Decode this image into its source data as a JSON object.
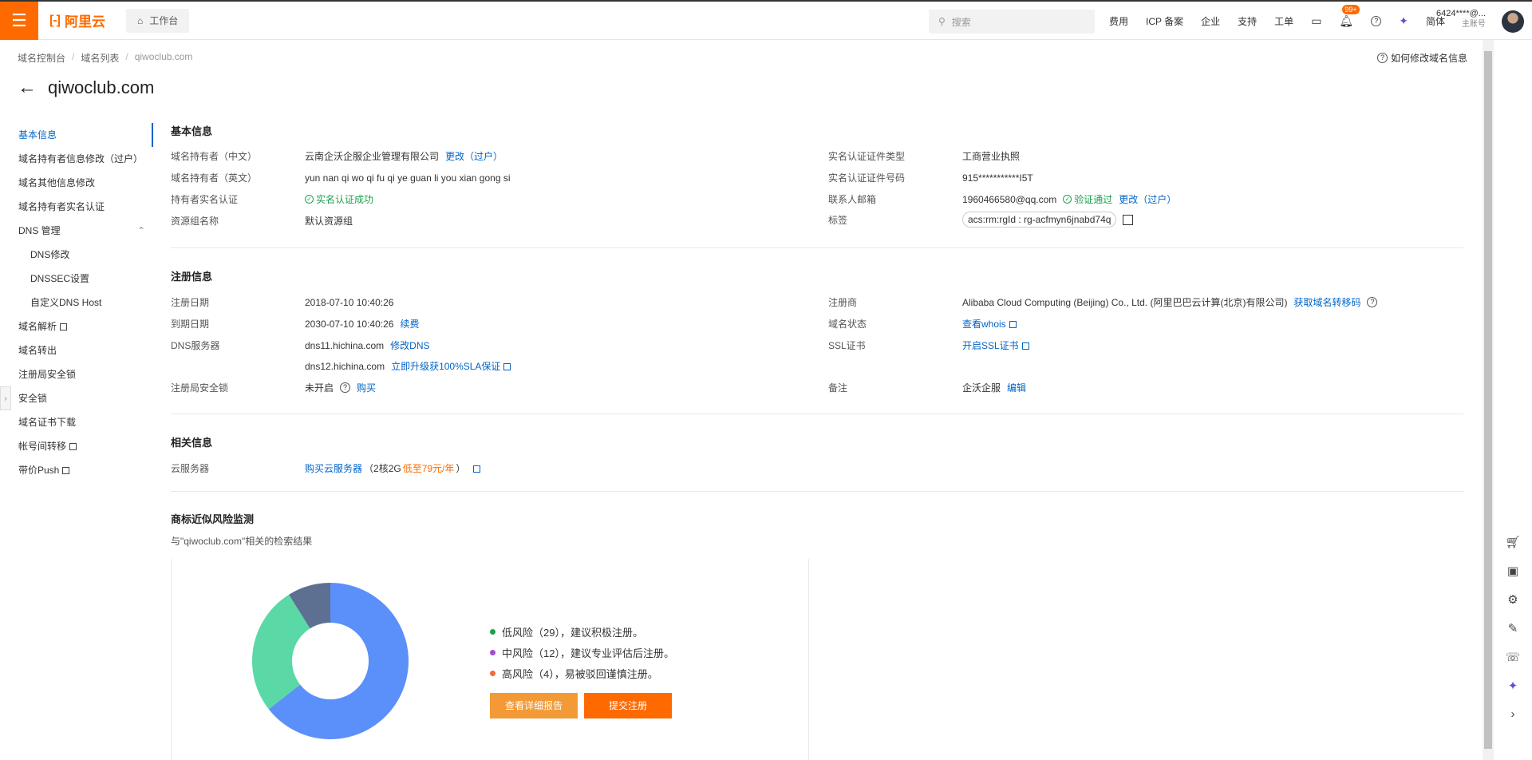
{
  "topbar": {
    "logo_text": "阿里云",
    "workspace": "工作台",
    "search_placeholder": "搜索",
    "nav": [
      "费用",
      "ICP 备案",
      "企业",
      "支持",
      "工单"
    ],
    "badge": "99+",
    "lang": "简体",
    "account_name": "6424****@...",
    "account_sub": "主账号"
  },
  "breadcrumb": [
    "域名控制台",
    "域名列表",
    "qiwoclub.com"
  ],
  "help_link": "如何修改域名信息",
  "title": "qiwoclub.com",
  "sidenav": {
    "items": [
      "基本信息",
      "域名持有者信息修改（过户）",
      "域名其他信息修改",
      "域名持有者实名认证",
      "DNS 管理",
      "DNS修改",
      "DNSSEC设置",
      "自定义DNS Host",
      "域名解析",
      "域名转出",
      "注册局安全锁",
      "安全锁",
      "域名证书下载",
      "帐号间转移",
      "带价Push"
    ]
  },
  "basic": {
    "title": "基本信息",
    "holder_cn_label": "域名持有者（中文）",
    "holder_cn_value": "云南企沃企服企业管理有限公司",
    "holder_cn_link": "更改（过户）",
    "holder_en_label": "域名持有者（英文）",
    "holder_en_value": "yun nan qi wo qi fu qi ye guan li you xian gong si",
    "realname_label": "持有者实名认证",
    "realname_value": "实名认证成功",
    "group_label": "资源组名称",
    "group_value": "默认资源组",
    "cert_type_label": "实名认证证件类型",
    "cert_type_value": "工商营业执照",
    "cert_no_label": "实名认证证件号码",
    "cert_no_value": "915***********I5T",
    "email_label": "联系人邮箱",
    "email_value": "1960466580@qq.com",
    "email_status": "验证通过",
    "email_link": "更改（过户）",
    "tag_label": "标签",
    "tag_value": "acs:rm:rgId : rg-acfmyn6jnabd74q"
  },
  "register": {
    "title": "注册信息",
    "reg_date_label": "注册日期",
    "reg_date_value": "2018-07-10 10:40:26",
    "exp_date_label": "到期日期",
    "exp_date_value": "2030-07-10 10:40:26",
    "renew_link": "续费",
    "dns_label": "DNS服务器",
    "dns1": "dns11.hichina.com",
    "dns1_link": "修改DNS",
    "dns2": "dns12.hichina.com",
    "dns2_link": "立即升级获100%SLA保证",
    "lock_label": "注册局安全锁",
    "lock_value": "未开启",
    "lock_link": "购买",
    "registrar_label": "注册商",
    "registrar_value": "Alibaba Cloud Computing (Beijing) Co., Ltd. (阿里巴巴云计算(北京)有限公司)",
    "registrar_link": "获取域名转移码",
    "status_label": "域名状态",
    "status_link": "查看whois",
    "ssl_label": "SSL证书",
    "ssl_link": "开启SSL证书",
    "note_label": "备注",
    "note_value": "企沃企服",
    "note_link": "编辑"
  },
  "related": {
    "title": "相关信息",
    "ecs_label": "云服务器",
    "ecs_link": "购买云服务器",
    "ecs_promo_pre": "（2核2G",
    "ecs_promo_price": "低至79元/年",
    "ecs_promo_post": "）"
  },
  "risk": {
    "title": "商标近似风险监测",
    "subtitle": "与\"qiwoclub.com\"相关的检索结果",
    "legend": [
      "低风险（29），建议积极注册。",
      "中风险（12），建议专业评估后注册。",
      "高风险（4），易被驳回谨慎注册。"
    ],
    "btn_report": "查看详细报告",
    "btn_register": "提交注册",
    "colors": {
      "low": "#5b8ff9",
      "mid": "#5ad8a6",
      "high": "#5d7092"
    }
  },
  "chart_data": {
    "type": "pie",
    "categories": [
      "低风险",
      "中风险",
      "高风险"
    ],
    "values": [
      29,
      12,
      4
    ],
    "title": "",
    "xlabel": "",
    "ylabel": ""
  }
}
